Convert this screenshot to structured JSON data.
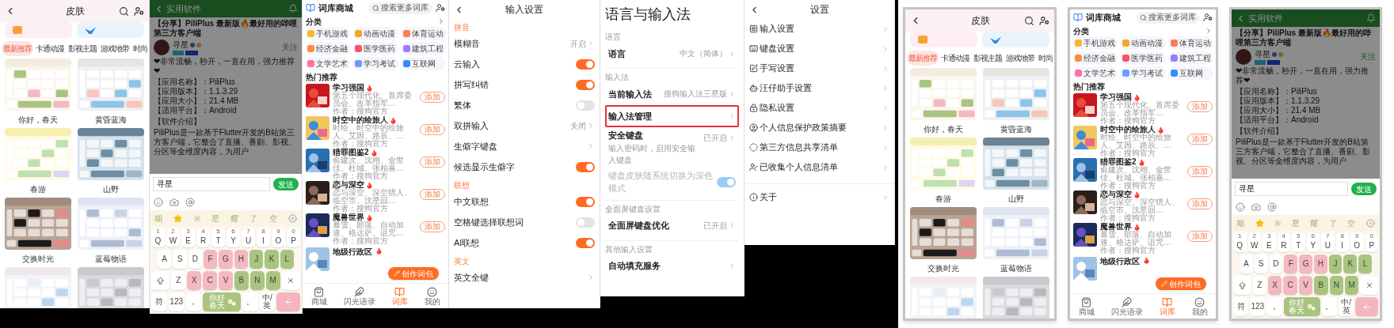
{
  "panels": [
    {
      "kind": "skins",
      "framed": false,
      "title": "皮肤",
      "tabs": [
        {
          "label": "最新推荐",
          "selected": true
        },
        {
          "label": "卡通动漫",
          "selected": false
        },
        {
          "label": "影视主题",
          "selected": false
        },
        {
          "label": "游戏地带",
          "selected": false
        },
        {
          "label": "时尚",
          "selected": false
        }
      ],
      "skins": [
        {
          "name": "你好，春天"
        },
        {
          "name": "黄昏蓝海"
        },
        {
          "name": "春游"
        },
        {
          "name": "山野"
        },
        {
          "name": "交换时光"
        },
        {
          "name": "蓝莓物语"
        }
      ]
    },
    {
      "kind": "chat",
      "framed": false,
      "header": "实用软件",
      "post": {
        "title": "【分享】PiliPlus 最新版🔥最好用的哔哩第三方客户端",
        "author": "寻星",
        "follow": "关注",
        "recommend": "❤非常流畅，秒开，一直在用，强力推荐❤",
        "info": [
          "【应用名称】：PiliPlus",
          "【应用版本】：1.1.3.29",
          "【应用大小】：21.4 MB",
          "【适用平台】：Android"
        ],
        "section": "【软件介绍】",
        "body": "PiliPlus是一款基于Flutter开发的B站第三方客户端，它整合了直播、番剧、影视、分区等全维度内容，为用户"
      },
      "input": "寻星",
      "send": "发送",
      "candidates": [
        {
          "kind": "text",
          "label": "期"
        },
        {
          "kind": "star"
        },
        {
          "kind": "text",
          "label": "※"
        },
        {
          "kind": "text",
          "label": "星"
        },
        {
          "kind": "text",
          "label": "耀"
        },
        {
          "kind": "text",
          "label": "了"
        },
        {
          "kind": "text",
          "label": "空"
        }
      ],
      "keys": [
        [
          {
            "kind": "letter",
            "label": "Q",
            "hint": "1",
            "color": "#ffffff"
          },
          {
            "kind": "letter",
            "label": "W",
            "hint": "2",
            "color": "#ffffff"
          },
          {
            "kind": "letter",
            "label": "E",
            "hint": "3",
            "color": "#ffffff"
          },
          {
            "kind": "letter",
            "label": "R",
            "hint": "4",
            "color": "#ffffff"
          },
          {
            "kind": "letter",
            "label": "T",
            "hint": "5",
            "color": "#ffffff"
          },
          {
            "kind": "letter",
            "label": "Y",
            "hint": "6",
            "color": "#ffffff"
          },
          {
            "kind": "letter",
            "label": "U",
            "hint": "7",
            "color": "#ffffff"
          },
          {
            "kind": "letter",
            "label": "I",
            "hint": "8",
            "color": "#ffffff"
          },
          {
            "kind": "letter",
            "label": "O",
            "hint": "9",
            "color": "#ffffff"
          },
          {
            "kind": "letter",
            "label": "P",
            "hint": "0",
            "color": "#ffffff"
          }
        ],
        [
          {
            "kind": "letter",
            "label": "A",
            "color": "#ffffff"
          },
          {
            "kind": "letter",
            "label": "S",
            "color": "#ffffff"
          },
          {
            "kind": "letter",
            "label": "D",
            "color": "#ffffff"
          },
          {
            "kind": "letter",
            "label": "F",
            "color": "#f4b8c1"
          },
          {
            "kind": "letter",
            "label": "G",
            "color": "#f4b8c1"
          },
          {
            "kind": "letter",
            "label": "H",
            "color": "#f4b8c1"
          },
          {
            "kind": "letter",
            "label": "J",
            "color": "#a9c47f"
          },
          {
            "kind": "letter",
            "label": "K",
            "color": "#a9c47f"
          },
          {
            "kind": "letter",
            "label": "L",
            "color": "#a9c47f"
          }
        ],
        [
          {
            "kind": "shift",
            "color": "#ffffff"
          },
          {
            "kind": "letter",
            "label": "Z",
            "color": "#ffffff"
          },
          {
            "kind": "letter",
            "label": "X",
            "color": "#f4b8c1"
          },
          {
            "kind": "letter",
            "label": "C",
            "color": "#f4b8c1"
          },
          {
            "kind": "letter",
            "label": "V",
            "color": "#f4b8c1"
          },
          {
            "kind": "letter",
            "label": "B",
            "color": "#a9c47f"
          },
          {
            "kind": "letter",
            "label": "N",
            "color": "#a9c47f"
          },
          {
            "kind": "letter",
            "label": "M",
            "color": "#a9c47f"
          },
          {
            "kind": "delete",
            "color": "#ffffff"
          }
        ],
        [
          {
            "kind": "letter",
            "label": "符",
            "color": "#ffffff"
          },
          {
            "kind": "letter",
            "label": "123",
            "color": "#ffffff"
          },
          {
            "kind": "letter",
            "label": "，",
            "color": "#ffffff"
          },
          {
            "kind": "space",
            "label": "你好春天",
            "color": "#a9c47f"
          },
          {
            "kind": "letter",
            "label": "。",
            "color": "#ffffff"
          },
          {
            "kind": "letter",
            "label": "中/英",
            "color": "#ffffff"
          },
          {
            "kind": "enter",
            "color": "#f5b5c0"
          }
        ]
      ]
    },
    {
      "kind": "store",
      "framed": false,
      "title": "词库商城",
      "search": "搜索更多词库",
      "category_heading": "分类",
      "categories": [
        "手机游戏",
        "动画动漫",
        "体育运动",
        "经济金融",
        "医学医药",
        "建筑工程",
        "文学艺术",
        "学习考试",
        "互联网"
      ],
      "hot_heading": "热门推荐",
      "items": [
        {
          "title": "学习强国",
          "desc": "第五个现代化、首席委员会、改革指军…",
          "author": "作者：搜狗官方",
          "action": "添加"
        },
        {
          "title": "时空中的绘旅人",
          "desc": "时绘、时空中的绘旅人、艾因、路辰、…",
          "author": "作者：搜狗官方",
          "action": "添加"
        },
        {
          "title": "猎罪图鉴2",
          "desc": "俞建次、沈翊、金世佳、杜城、张柏嘉…",
          "author": "作者：搜狗官方",
          "action": "添加"
        },
        {
          "title": "恋与深空",
          "desc": "恋与深空、深空猎人、临空市、沈星回…",
          "author": "作者：搜狗官方",
          "action": "添加"
        },
        {
          "title": "魔兽世界",
          "desc": "暴雪、部落、自动加速、格达萨、诅咒…",
          "author": "作者：搜狗官方",
          "action": "添加"
        }
      ],
      "partial_item": "地级行政区",
      "fab": "创作词包",
      "nav": [
        {
          "label": "商城",
          "selected": false
        },
        {
          "label": "闪光语录",
          "selected": false
        },
        {
          "label": "词库",
          "selected": true
        },
        {
          "label": "我的",
          "selected": false
        }
      ]
    },
    {
      "kind": "input_settings",
      "framed": false,
      "title": "输入设置",
      "groups": [
        {
          "heading": "拼音",
          "rows": [
            {
              "kind": "value",
              "label": "模糊音",
              "value": "开启"
            },
            {
              "kind": "toggle",
              "label": "云输入",
              "on": true
            },
            {
              "kind": "toggle",
              "label": "拼写纠错",
              "on": true
            },
            {
              "kind": "toggle",
              "label": "繁体",
              "on": false
            },
            {
              "kind": "value",
              "label": "双拼输入",
              "value": "关闭"
            },
            {
              "kind": "link",
              "label": "生僻字键盘"
            },
            {
              "kind": "toggle",
              "label": "候选显示生僻字",
              "on": true
            }
          ]
        },
        {
          "heading": "联想",
          "rows": [
            {
              "kind": "toggle",
              "label": "中文联想",
              "on": true
            },
            {
              "kind": "toggle",
              "label": "空格键选择联想词",
              "on": false
            },
            {
              "kind": "toggle",
              "label": "AI联想",
              "on": true
            }
          ]
        },
        {
          "heading": "英文",
          "rows": [
            {
              "kind": "link",
              "label": "英文全键"
            }
          ]
        }
      ]
    },
    {
      "kind": "language",
      "framed": false,
      "title": "语言与输入法",
      "groups": [
        {
          "heading": "语言",
          "rows": [
            {
              "kind": "value",
              "label": "语言",
              "value": "中文（简体）",
              "highlighted": false,
              "disabled": false
            }
          ]
        },
        {
          "heading": "输入法",
          "rows": [
            {
              "kind": "value",
              "label": "当前输入法",
              "value": "搜狗输入法三星版",
              "highlighted": false,
              "disabled": false
            },
            {
              "kind": "link",
              "label": "输入法管理",
              "highlighted": true,
              "disabled": false
            },
            {
              "kind": "value",
              "label": "安全键盘",
              "detail": "输入密码时，启用安全输入键盘",
              "value": "已开启",
              "highlighted": false,
              "disabled": false
            },
            {
              "kind": "toggle",
              "label": "键盘皮肤随系统切换为深色模式",
              "on": true,
              "highlighted": false,
              "disabled": true
            }
          ]
        },
        {
          "heading": "全面屏键盘设置",
          "rows": [
            {
              "kind": "value",
              "label": "全面屏键盘优化",
              "value": "已开启",
              "highlighted": false,
              "disabled": false
            }
          ]
        },
        {
          "heading": "其他输入设置",
          "rows": [
            {
              "kind": "link",
              "label": "自动填充服务",
              "highlighted": false,
              "disabled": false
            }
          ]
        }
      ]
    },
    {
      "kind": "settings",
      "framed": false,
      "title": "设置",
      "groups": [
        [
          "输入设置",
          "键盘设置",
          "手写设置",
          "汪仔助手设置",
          "隐私设置",
          "个人信息保护政策摘要",
          "第三方信息共享清单",
          "已收集个人信息清单"
        ],
        [
          "关于"
        ]
      ]
    },
    {
      "kind": "skins",
      "framed": true,
      "title": "皮肤",
      "tabs": [
        {
          "label": "最新推荐",
          "selected": true
        },
        {
          "label": "卡通动漫",
          "selected": false
        },
        {
          "label": "影视主题",
          "selected": false
        },
        {
          "label": "游戏地带",
          "selected": false
        },
        {
          "label": "时尚",
          "selected": false
        }
      ],
      "skins": [
        {
          "name": "你好，春天"
        },
        {
          "name": "黄昏蓝海"
        },
        {
          "name": "春游"
        },
        {
          "name": "山野"
        },
        {
          "name": "交换时光"
        },
        {
          "name": "蓝莓物语"
        }
      ]
    },
    {
      "kind": "store",
      "framed": true,
      "title": "词库商城",
      "search": "搜索更多词库",
      "category_heading": "分类",
      "categories": [
        "手机游戏",
        "动画动漫",
        "体育运动",
        "经济金融",
        "医学医药",
        "建筑工程",
        "文学艺术",
        "学习考试",
        "互联网"
      ],
      "hot_heading": "热门推荐",
      "items": [
        {
          "title": "学习强国",
          "desc": "第五个现代化、首席委员会、改革指军…",
          "author": "作者：搜狗官方",
          "action": "添加"
        },
        {
          "title": "时空中的绘旅人",
          "desc": "时绘、时空中的绘旅人、艾因、路辰、…",
          "author": "作者：搜狗官方",
          "action": "添加"
        },
        {
          "title": "猎罪图鉴2",
          "desc": "俞建次、沈翊、金世佳、杜城、张柏嘉…",
          "author": "作者：搜狗官方",
          "action": "添加"
        },
        {
          "title": "恋与深空",
          "desc": "恋与深空、深空猎人、临空市、沈星回…",
          "author": "作者：搜狗官方",
          "action": "添加"
        },
        {
          "title": "魔兽世界",
          "desc": "暴雪、部落、自动加速、格达萨、诅咒…",
          "author": "作者：搜狗官方",
          "action": "添加"
        }
      ],
      "partial_item": "地级行政区",
      "fab": "创作词包",
      "nav": [
        {
          "label": "商城",
          "selected": false
        },
        {
          "label": "闪光语录",
          "selected": false
        },
        {
          "label": "词库",
          "selected": true
        },
        {
          "label": "我的",
          "selected": false
        }
      ]
    },
    {
      "kind": "chat",
      "framed": true,
      "header": "实用软件",
      "post": {
        "title": "【分享】PiliPlus 最新版🔥最好用的哔哩第三方客户端",
        "author": "寻星",
        "follow": "关注",
        "recommend": "❤非常流畅，秒开，一直在用，强力推荐❤",
        "info": [
          "【应用名称】：PiliPlus",
          "【应用版本】：1.1.3.29",
          "【应用大小】：21.4 MB",
          "【适用平台】：Android"
        ],
        "section": "【软件介绍】",
        "body": "PiliPlus是一款基于Flutter开发的B站第三方客户端，它整合了直播、番剧、影视、分区等全维度内容，为用户"
      },
      "input": "寻星",
      "send": "发送",
      "candidates": [
        {
          "kind": "text",
          "label": "期"
        },
        {
          "kind": "star"
        },
        {
          "kind": "text",
          "label": "※"
        },
        {
          "kind": "text",
          "label": "星"
        },
        {
          "kind": "text",
          "label": "耀"
        },
        {
          "kind": "text",
          "label": "了"
        },
        {
          "kind": "text",
          "label": "空"
        }
      ],
      "keys": [
        [
          {
            "kind": "letter",
            "label": "Q",
            "hint": "1",
            "color": "#ffffff"
          },
          {
            "kind": "letter",
            "label": "W",
            "hint": "2",
            "color": "#ffffff"
          },
          {
            "kind": "letter",
            "label": "E",
            "hint": "3",
            "color": "#ffffff"
          },
          {
            "kind": "letter",
            "label": "R",
            "hint": "4",
            "color": "#ffffff"
          },
          {
            "kind": "letter",
            "label": "T",
            "hint": "5",
            "color": "#ffffff"
          },
          {
            "kind": "letter",
            "label": "Y",
            "hint": "6",
            "color": "#ffffff"
          },
          {
            "kind": "letter",
            "label": "U",
            "hint": "7",
            "color": "#ffffff"
          },
          {
            "kind": "letter",
            "label": "I",
            "hint": "8",
            "color": "#ffffff"
          },
          {
            "kind": "letter",
            "label": "O",
            "hint": "9",
            "color": "#ffffff"
          },
          {
            "kind": "letter",
            "label": "P",
            "hint": "0",
            "color": "#ffffff"
          }
        ],
        [
          {
            "kind": "letter",
            "label": "A",
            "color": "#ffffff"
          },
          {
            "kind": "letter",
            "label": "S",
            "color": "#ffffff"
          },
          {
            "kind": "letter",
            "label": "D",
            "color": "#ffffff"
          },
          {
            "kind": "letter",
            "label": "F",
            "color": "#f4b8c1"
          },
          {
            "kind": "letter",
            "label": "G",
            "color": "#f4b8c1"
          },
          {
            "kind": "letter",
            "label": "H",
            "color": "#f4b8c1"
          },
          {
            "kind": "letter",
            "label": "J",
            "color": "#a9c47f"
          },
          {
            "kind": "letter",
            "label": "K",
            "color": "#a9c47f"
          },
          {
            "kind": "letter",
            "label": "L",
            "color": "#a9c47f"
          }
        ],
        [
          {
            "kind": "shift",
            "color": "#ffffff"
          },
          {
            "kind": "letter",
            "label": "Z",
            "color": "#ffffff"
          },
          {
            "kind": "letter",
            "label": "X",
            "color": "#f4b8c1"
          },
          {
            "kind": "letter",
            "label": "C",
            "color": "#f4b8c1"
          },
          {
            "kind": "letter",
            "label": "V",
            "color": "#f4b8c1"
          },
          {
            "kind": "letter",
            "label": "B",
            "color": "#a9c47f"
          },
          {
            "kind": "letter",
            "label": "N",
            "color": "#a9c47f"
          },
          {
            "kind": "letter",
            "label": "M",
            "color": "#a9c47f"
          },
          {
            "kind": "delete",
            "color": "#ffffff"
          }
        ],
        [
          {
            "kind": "letter",
            "label": "符",
            "color": "#ffffff"
          },
          {
            "kind": "letter",
            "label": "123",
            "color": "#ffffff"
          },
          {
            "kind": "letter",
            "label": "，",
            "color": "#ffffff"
          },
          {
            "kind": "space",
            "label": "你好春天",
            "color": "#a9c47f"
          },
          {
            "kind": "letter",
            "label": "。",
            "color": "#ffffff"
          },
          {
            "kind": "letter",
            "label": "中/英",
            "color": "#ffffff"
          },
          {
            "kind": "enter",
            "color": "#f5b5c0"
          }
        ]
      ]
    }
  ]
}
